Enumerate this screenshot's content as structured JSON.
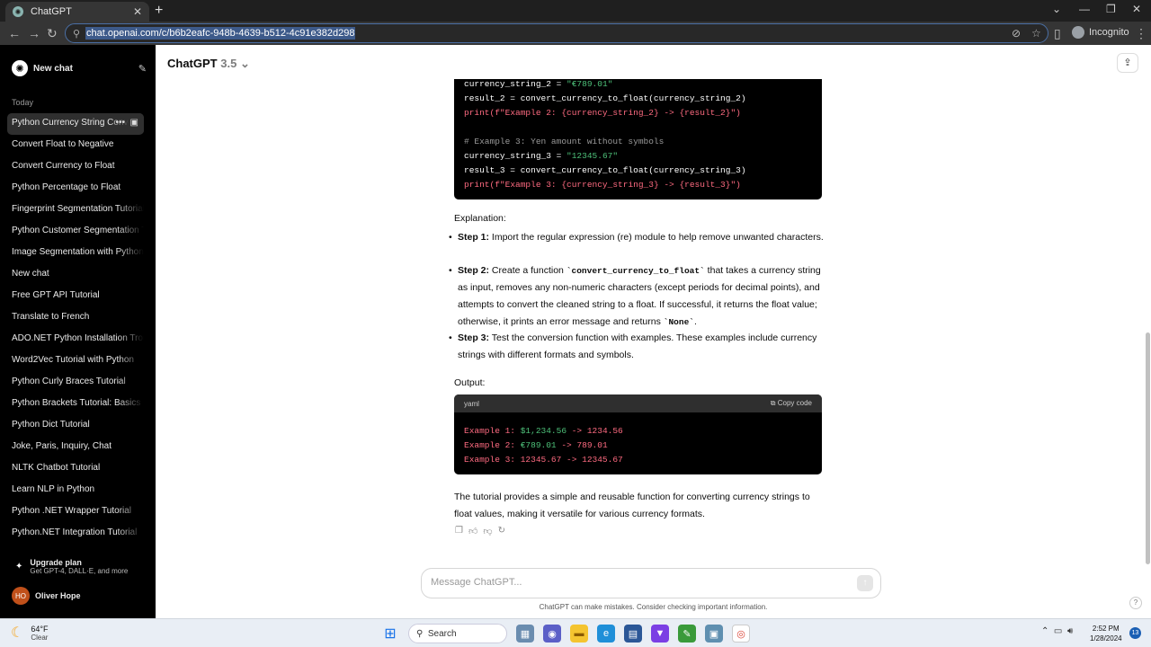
{
  "browser": {
    "tab_title": "ChatGPT",
    "url": "chat.openai.com/c/b6b2eafc-948b-4639-b512-4c91e382d298",
    "incognito_label": "Incognito"
  },
  "sidebar": {
    "new_chat": "New chat",
    "section_today": "Today",
    "chats": [
      "Python Currency String Conversion",
      "Convert Float to Negative",
      "Convert Currency to Float",
      "Python Percentage to Float",
      "Fingerprint Segmentation Tutorial",
      "Python Customer Segmentation Tutorial",
      "Image Segmentation with Python",
      "New chat",
      "Free GPT API Tutorial",
      "Translate to French",
      "ADO.NET Python Installation Trouble",
      "Word2Vec Tutorial with Python",
      "Python Curly Braces Tutorial",
      "Python Brackets Tutorial: Basics",
      "Python Dict Tutorial",
      "Joke, Paris, Inquiry, Chat",
      "NLTK Chatbot Tutorial",
      "Learn NLP in Python",
      "Python .NET Wrapper Tutorial",
      "Python.NET Integration Tutorial"
    ],
    "upgrade_title": "Upgrade plan",
    "upgrade_sub": "Get GPT-4, DALL·E, and more",
    "user_initials": "HO",
    "user_name": "Oliver Hope"
  },
  "header": {
    "model": "ChatGPT",
    "version": "3.5"
  },
  "code1": {
    "l1a": "currency_string_2 = ",
    "l1b": "\"€789.01\"",
    "l2": "result_2 = convert_currency_to_float(currency_string_2)",
    "l3a": "print",
    "l3b": "(f\"Example 2: {currency_string_2} -> {result_2}\")",
    "l5": "# Example 3: Yen amount without symbols",
    "l6a": "currency_string_3 = ",
    "l6b": "\"12345.67\"",
    "l7": "result_3 = convert_currency_to_float(currency_string_3)",
    "l8a": "print",
    "l8b": "(f\"Example 3: {currency_string_3} -> {result_3}\")"
  },
  "explanation": {
    "heading": "Explanation:",
    "step1_label": "Step 1:",
    "step1_text": " Import the regular expression (re) module to help remove unwanted characters.",
    "step2_label": "Step 2:",
    "step2_a": " Create a function ",
    "step2_code": "`convert_currency_to_float`",
    "step2_b": " that takes a currency string as input, removes any non-numeric characters (except periods for decimal points), and attempts to convert the cleaned string to a float. If successful, it returns the float value; otherwise, it prints an error message and returns ",
    "step2_none": "`None`",
    "step2_end": ".",
    "step3_label": "Step 3:",
    "step3_text": " Test the conversion function with examples. These examples include currency strings with different formats and symbols."
  },
  "output": {
    "heading": "Output:",
    "lang": "yaml",
    "copy_label": "Copy code",
    "lines": [
      {
        "k": "Example 1: ",
        "v": "$1,234.56",
        "r": " -> 1234.56"
      },
      {
        "k": "Example 2: ",
        "v": "€789.01",
        "r": " -> 789.01"
      },
      {
        "k": "Example 3: ",
        "v": "12345.67",
        "r": " -> 12345.67"
      }
    ]
  },
  "tutorial_text": "The tutorial provides a simple and reusable function for converting currency strings to float values, making it versatile for various currency formats.",
  "composer": {
    "placeholder": "Message ChatGPT...",
    "disclaimer": "ChatGPT can make mistakes. Consider checking important information."
  },
  "taskbar": {
    "temp": "64°F",
    "condition": "Clear",
    "search": "Search",
    "time": "2:52 PM",
    "date": "1/28/2024",
    "notifications": "13"
  }
}
